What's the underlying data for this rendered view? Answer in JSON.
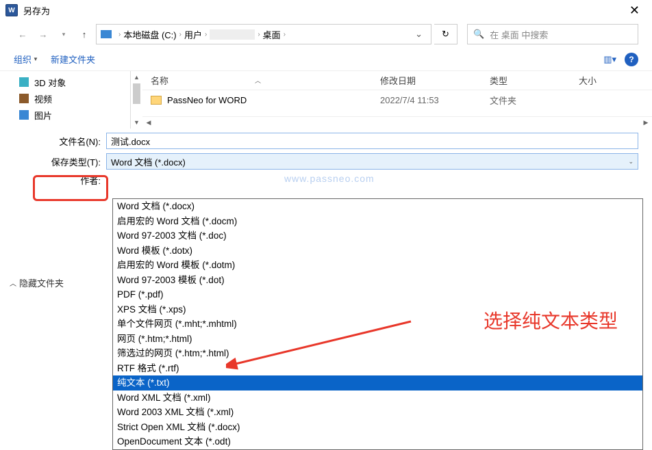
{
  "window": {
    "title": "另存为"
  },
  "breadcrumb": {
    "root": "本地磁盘 (C:)",
    "p1": "用户",
    "p3": "桌面"
  },
  "search": {
    "placeholder": "在 桌面 中搜索"
  },
  "toolbar": {
    "organize": "组织",
    "new_folder": "新建文件夹"
  },
  "sidebar": {
    "items": [
      {
        "label": "3D 对象"
      },
      {
        "label": "视频"
      },
      {
        "label": "图片"
      }
    ]
  },
  "headers": {
    "name": "名称",
    "date": "修改日期",
    "type": "类型",
    "size": "大小"
  },
  "rows": [
    {
      "name": "PassNeo for WORD",
      "date": "2022/7/4 11:53",
      "type": "文件夹"
    }
  ],
  "fields": {
    "filename_label": "文件名(N):",
    "filename_value": "测试.docx",
    "savetype_label": "保存类型(T):",
    "savetype_value": "Word 文档 (*.docx)",
    "author_label": "作者:"
  },
  "dropdown_items": [
    "Word 文档 (*.docx)",
    "启用宏的 Word 文档 (*.docm)",
    "Word 97-2003 文档 (*.doc)",
    "Word 模板 (*.dotx)",
    "启用宏的 Word 模板 (*.dotm)",
    "Word 97-2003 模板 (*.dot)",
    "PDF (*.pdf)",
    "XPS 文档 (*.xps)",
    "单个文件网页 (*.mht;*.mhtml)",
    "网页 (*.htm;*.html)",
    "筛选过的网页 (*.htm;*.html)",
    "RTF 格式 (*.rtf)",
    "纯文本 (*.txt)",
    "Word XML 文档 (*.xml)",
    "Word 2003 XML 文档 (*.xml)",
    "Strict Open XML 文档 (*.docx)",
    "OpenDocument 文本 (*.odt)"
  ],
  "dropdown_highlighted_index": 12,
  "annotation": "选择纯文本类型",
  "hide_folders": "隐藏文件夹",
  "watermark": "www.passneo.com"
}
